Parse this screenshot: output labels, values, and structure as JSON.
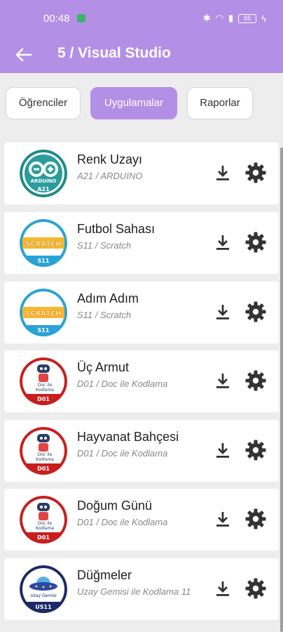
{
  "status_bar": {
    "time": "00:48",
    "battery": "55"
  },
  "app_bar": {
    "title": "5 / Visual Studio"
  },
  "tabs": [
    {
      "label": "Öğrenciler",
      "active": false
    },
    {
      "label": "Uygulamalar",
      "active": true
    },
    {
      "label": "Raporlar",
      "active": false
    }
  ],
  "items": [
    {
      "title": "Renk Uzayı",
      "subtitle": "A21 / ARDUINO",
      "logo": "arduino-logo",
      "logo_text": "ARDUINO",
      "badge": "A21"
    },
    {
      "title": "Futbol Sahası",
      "subtitle": "S11 / Scratch",
      "logo": "scratch-logo",
      "logo_text": "SCRATCH",
      "badge": "S11"
    },
    {
      "title": "Adım Adım",
      "subtitle": "S11 / Scratch",
      "logo": "scratch-logo",
      "logo_text": "SCRATCH",
      "badge": "S11"
    },
    {
      "title": "Üç Armut",
      "subtitle": "D01 / Doc ile Kodlama",
      "logo": "doc-robot-logo",
      "logo_text": "Doc ile Kodlama",
      "badge": "D01"
    },
    {
      "title": "Hayvanat Bahçesi",
      "subtitle": "D01 / Doc ile Kodlama",
      "logo": "doc-robot-logo",
      "logo_text": "Doc ile Kodlama",
      "badge": "D01"
    },
    {
      "title": "Doğum Günü",
      "subtitle": "D01 / Doc ile Kodlama",
      "logo": "doc-robot-logo",
      "logo_text": "Doc ile Kodlama",
      "badge": "D01"
    },
    {
      "title": "Düğmeler",
      "subtitle": "Uzay Gemisi ile Kodlama 11",
      "logo": "ufo-logo",
      "logo_text": "Uzay Gemisi",
      "badge": "US11"
    }
  ],
  "colors": {
    "accent": "#b48fe6",
    "icon": "#333333"
  }
}
